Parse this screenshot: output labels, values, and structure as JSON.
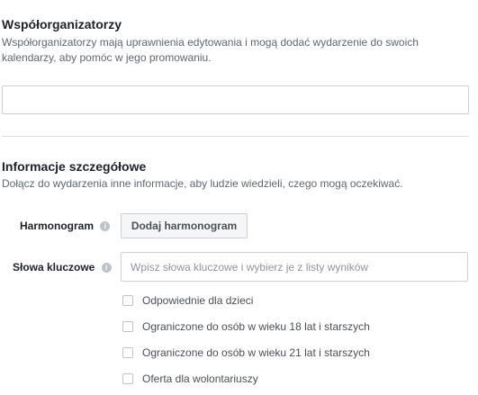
{
  "cohosts": {
    "title": "Współorganizatorzy",
    "description_line1": "Współorganizatorzy mają uprawnienia edytowania i mogą dodać wydarzenie do swoich",
    "description_line2": "kalendarzy, aby pomóc w jego promowaniu.",
    "input_value": ""
  },
  "details": {
    "title": "Informacje szczegółowe",
    "description": "Dołącz do wydarzenia inne informacje, aby ludzie wiedzieli, czego mogą oczekiwać.",
    "schedule_label": "Harmonogram",
    "schedule_button": "Dodaj harmonogram",
    "keywords_label": "Słowa kluczowe",
    "keywords_placeholder": "Wpisz słowa kluczowe i wybierz je z listy wyników",
    "info_icon": "info-icon",
    "info_glyph": "i"
  },
  "options": [
    {
      "label": "Odpowiednie dla dzieci",
      "checked": false
    },
    {
      "label": "Ograniczone do osób w wieku 18 lat i starszych",
      "checked": false
    },
    {
      "label": "Ograniczone do osób w wieku 21 lat i starszych",
      "checked": false
    },
    {
      "label": "Oferta dla wolontariuszy",
      "checked": false
    }
  ]
}
